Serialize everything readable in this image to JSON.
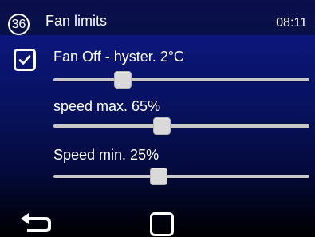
{
  "header": {
    "screen_number": "36",
    "title": "Fan limits",
    "time": "08:11"
  },
  "settings": [
    {
      "id": "fan-off-hysteresis",
      "label": "Fan Off - hyster.  2°C",
      "slider_fraction": 0.27
    },
    {
      "id": "speed-max",
      "label": "speed max. 65%",
      "slider_fraction": 0.425
    },
    {
      "id": "speed-min",
      "label": "Speed min. 25%",
      "slider_fraction": 0.41
    }
  ],
  "fan_off_enabled": true,
  "icons": {
    "checkbox": "checkbox-checked-icon",
    "back": "back-arrow-icon",
    "home": "square-home-icon"
  },
  "colors": {
    "background_top": "#101a88",
    "background_bottom": "#000000",
    "header": "#0a0f4d",
    "text": "#ffffff",
    "slider_track": "#c8c8c8",
    "slider_thumb": "#d9d9d9"
  }
}
